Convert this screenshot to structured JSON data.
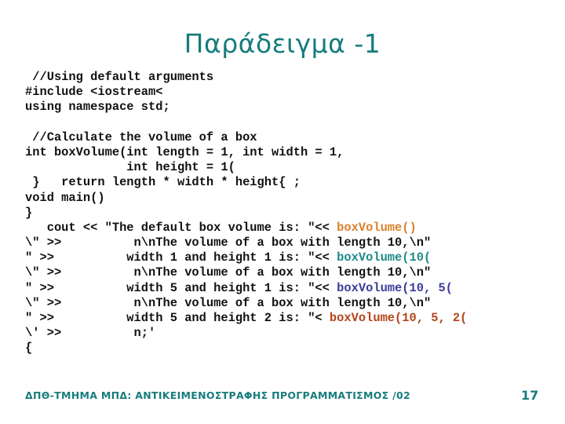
{
  "slide": {
    "title": "Παράδειγμα -1",
    "code_lines": [
      {
        "text": " //Using default arguments"
      },
      {
        "text": "#include <iostream<"
      },
      {
        "text": "using namespace std;"
      },
      {
        "text": ""
      },
      {
        "text": " //Calculate the volume of a box"
      },
      {
        "text": "int boxVolume(int length = 1, int width = 1,"
      },
      {
        "text": "              int height = 1("
      },
      {
        "text": " }   return length * width * height{ ;"
      },
      {
        "text": "void main()"
      },
      {
        "text": "}"
      },
      {
        "text": "   cout << \"The default box volume is: \"<< ",
        "call": "boxVolume()",
        "call_color": "#d9822b"
      },
      {
        "text": "\\\" >>          n\\nThe volume of a box with length 10,\\n\""
      },
      {
        "text": "\" >>          width 1 and height 1 is: \"<< ",
        "call": "boxVolume(10(",
        "call_color": "#1f8a8a"
      },
      {
        "text": "\\\" >>          n\\nThe volume of a box with length 10,\\n\""
      },
      {
        "text": "\" >>          width 5 and height 1 is: \"<< ",
        "call": "boxVolume(10, 5(",
        "call_color": "#3b3b9a"
      },
      {
        "text": "\\\" >>          n\\nThe volume of a box with length 10,\\n\""
      },
      {
        "text": "\" >>          width 5 and height 2 is: \"< ",
        "call": "boxVolume(10, 5, 2(",
        "call_color": "#b5451b"
      },
      {
        "text": "\\' >>          n;'"
      },
      {
        "text": "{"
      }
    ],
    "footer": "ΔΠΘ-ΤΜΗΜΑ ΜΠΔ: ΑΝΤΙΚΕΙΜΕΝΟΣΤΡΑΦΗΣ ΠΡΟΓΡΑΜΜΑΤΙΣΜΟΣ /02",
    "page_number": "17"
  },
  "colors": {
    "accent": "#177c7c",
    "text": "#111111"
  }
}
